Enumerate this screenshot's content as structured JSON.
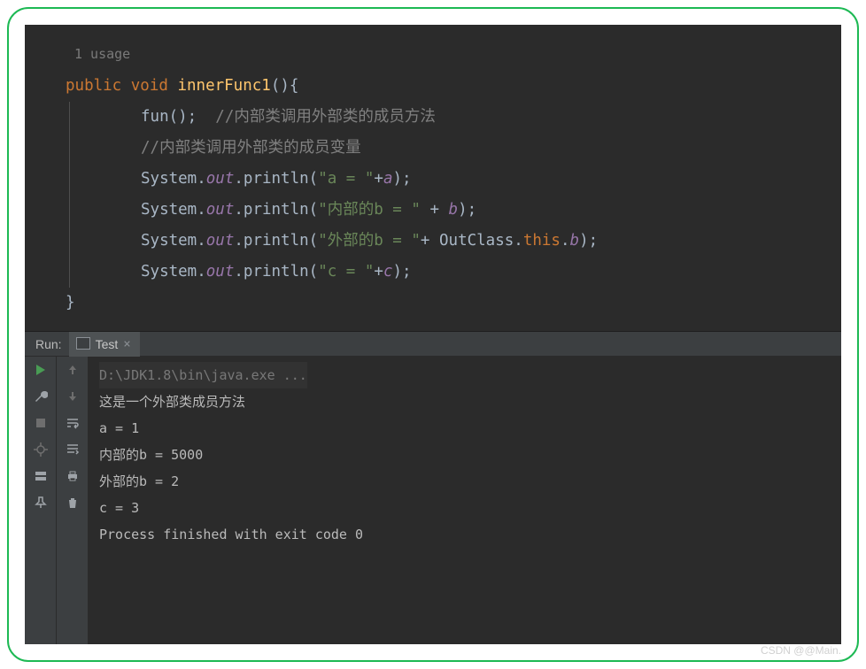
{
  "editor": {
    "usage": "1 usage",
    "sig": {
      "kw1": "public",
      "kw2": "void",
      "fn": "innerFunc1",
      "parens": "(){"
    },
    "l2": {
      "call": "fun();",
      "comment": "  //内部类调用外部类的成员方法"
    },
    "l3": {
      "comment": "//内部类调用外部类的成员变量"
    },
    "l4": {
      "p1": "System.",
      "p2": "out",
      "p3": ".println(",
      "str": "\"a = \"",
      "p4": "+",
      "var": "a",
      "p5": ");"
    },
    "l5": {
      "p1": "System.",
      "p2": "out",
      "p3": ".println(",
      "str": "\"内部的b = \"",
      "p4": " + ",
      "var": "b",
      "p5": ");"
    },
    "l6": {
      "p1": "System.",
      "p2": "out",
      "p3": ".println(",
      "str": "\"外部的b = \"",
      "p4": "+ OutClass.",
      "kw": "this",
      "p5": ".",
      "var": "b",
      "p6": ");"
    },
    "l7": {
      "p1": "System.",
      "p2": "out",
      "p3": ".println(",
      "str": "\"c = \"",
      "p4": "+",
      "var": "c",
      "p5": ");"
    },
    "close": "}"
  },
  "run": {
    "label": "Run:",
    "tab": {
      "name": "Test",
      "close": "×"
    },
    "console": {
      "cmd": "D:\\JDK1.8\\bin\\java.exe ...",
      "l1": "这是一个外部类成员方法",
      "l2": "a = 1",
      "l3": "内部的b = 5000",
      "l4": "外部的b = 2",
      "l5": "c = 3",
      "blank": " ",
      "exit": "Process finished with exit code 0"
    }
  },
  "watermark": "CSDN @@Main."
}
